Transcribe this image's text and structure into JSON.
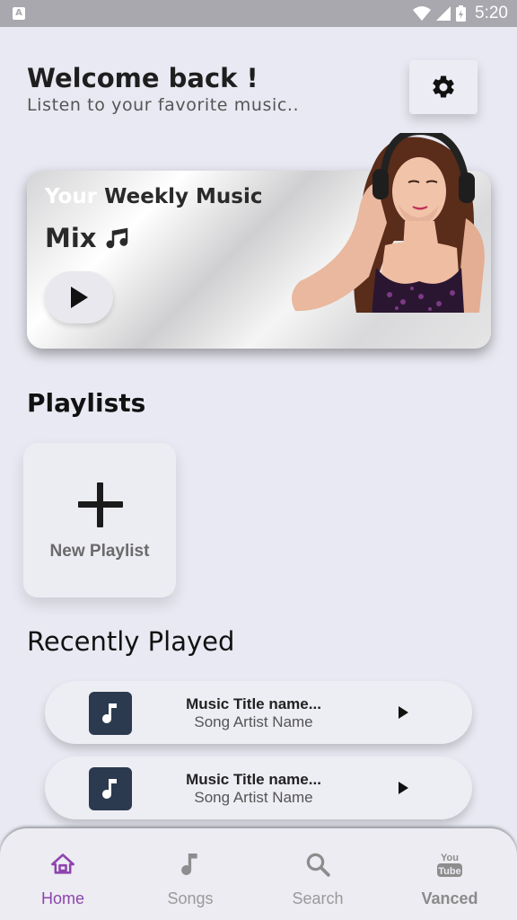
{
  "status_bar": {
    "app_badge": "A",
    "time": "5:20"
  },
  "header": {
    "title": "Welcome back !",
    "subtitle": "Listen to your favorite music..",
    "settings_icon": "gear-icon"
  },
  "weekly_mix": {
    "title_part1": "Your",
    "title_part2": "Weekly Music",
    "title_line2": "Mix",
    "music_icon": "music-note-icon",
    "play_icon": "play-icon"
  },
  "playlists": {
    "title": "Playlists",
    "new_playlist_label": "New Playlist"
  },
  "recently_played": {
    "title": "Recently Played",
    "tracks": [
      {
        "title": "Music Title name...",
        "artist": "Song Artist Name"
      },
      {
        "title": "Music Title name...",
        "artist": "Song Artist Name"
      }
    ]
  },
  "bottom_nav": {
    "items": [
      {
        "label": "Home",
        "icon": "home-icon",
        "active": true
      },
      {
        "label": "Songs",
        "icon": "music-note-icon",
        "active": false
      },
      {
        "label": "Search",
        "icon": "search-icon",
        "active": false
      },
      {
        "label": "Vanced",
        "icon": "youtube-icon",
        "active": false,
        "icon_text": [
          "You",
          "Tube"
        ]
      }
    ]
  },
  "colors": {
    "background": "#e9e9f3",
    "accent": "#8e44ad",
    "track_art": "#2b3a4e"
  }
}
